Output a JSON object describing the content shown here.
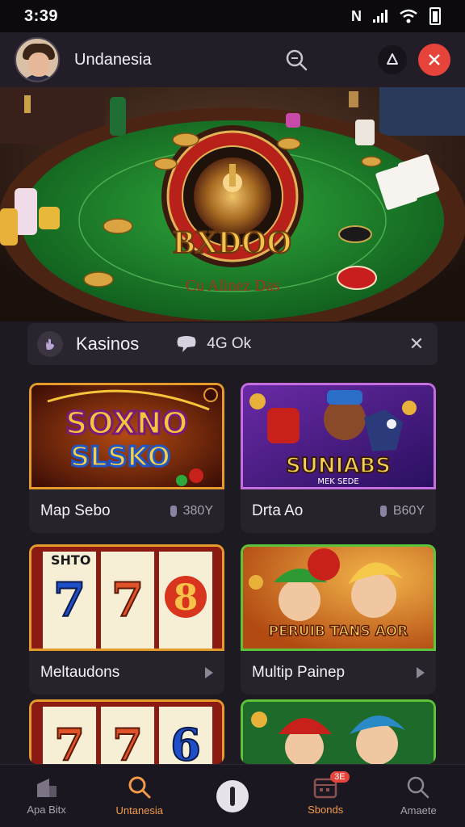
{
  "status_bar": {
    "time": "3:39",
    "nfc": "N"
  },
  "header": {
    "title": "Undanesia"
  },
  "hero": {
    "wheel_text": "BXDOO",
    "table_text": "Cu Alinez Das"
  },
  "filter": {
    "label": "Kasinos",
    "count": "4G Ok"
  },
  "games": [
    {
      "title": "Map Sebo",
      "value": "380Y",
      "art_text": [
        "SOXNO",
        "SLSKO"
      ]
    },
    {
      "title": "Drta Ao",
      "value": "B60Y",
      "art_text": [
        "SUNIABS",
        "MEK SEDE"
      ]
    },
    {
      "title": "Meltaudons",
      "art_text": [
        "SHTO"
      ]
    },
    {
      "title": "Multip Painep",
      "art_text": [
        "PERUIB TANS AOR"
      ]
    }
  ],
  "bottom_nav": [
    {
      "label": "Apa Bitx"
    },
    {
      "label": "Untanesia"
    },
    {
      "label": ""
    },
    {
      "label": "Sbonds",
      "badge": "3E"
    },
    {
      "label": "Amaete"
    }
  ],
  "colors": {
    "accent": "#e6443a",
    "active_nav": "#f39a4a",
    "card_border_orange": "#e59a2c",
    "card_border_purple": "#c46fe0",
    "card_border_green": "#5fc23b"
  }
}
